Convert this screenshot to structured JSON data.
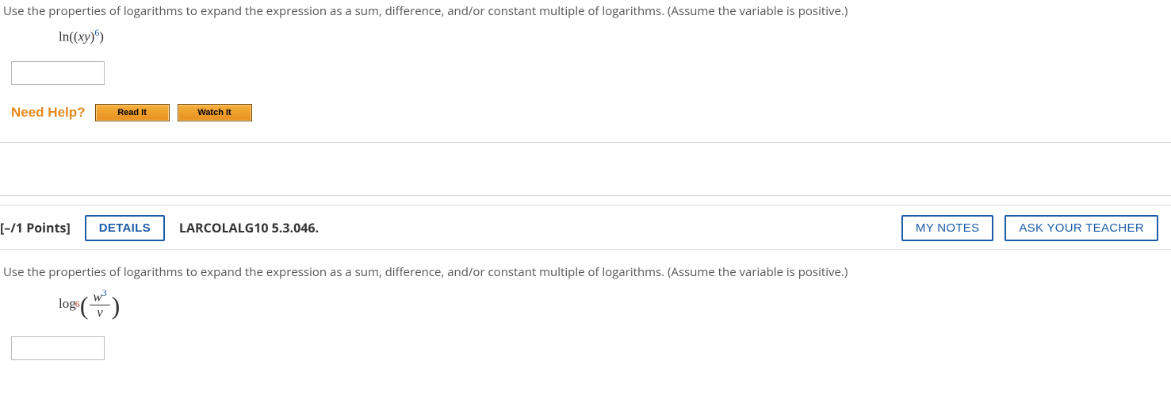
{
  "q1": {
    "prompt": "Use the properties of logarithms to expand the expression as a sum, difference, and/or constant multiple of logarithms. (Assume the variable is positive.)",
    "expr_prefix": "ln((",
    "expr_var": "xy",
    "expr_close": ")",
    "expr_exp": "6",
    "expr_end": ")",
    "answer_value": ""
  },
  "help": {
    "label": "Need Help?",
    "read": "Read It",
    "watch": "Watch It"
  },
  "header": {
    "points": "[–/1 Points]",
    "details": "DETAILS",
    "book": "LARCOLALG10 5.3.046.",
    "notes": "MY NOTES",
    "ask": "ASK YOUR TEACHER"
  },
  "q2": {
    "prompt": "Use the properties of logarithms to expand the expression as a sum, difference, and/or constant multiple of logarithms. (Assume the variable is positive.)",
    "log_label": "log",
    "log_base": "6",
    "num_var": "w",
    "num_exp": "3",
    "den_var": "v",
    "answer_value": ""
  }
}
